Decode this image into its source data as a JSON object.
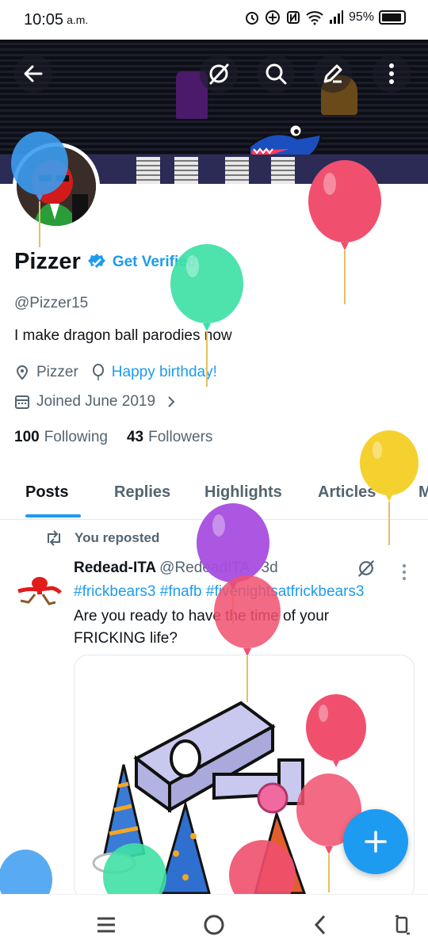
{
  "status_bar": {
    "time": "10:05",
    "ampm": "a.m.",
    "battery": "95%"
  },
  "icons": {
    "back": "back-arrow-icon",
    "grok": "grok-icon",
    "search": "search-icon",
    "edit": "edit-pencil-icon",
    "more": "more-vertical-icon",
    "verified": "verified-badge-icon",
    "location": "location-pin-icon",
    "birthday": "balloon-icon",
    "calendar": "calendar-icon",
    "repost": "repost-icon",
    "compose": "plus-icon"
  },
  "profile": {
    "name": "Pizzer",
    "get_verified": "Get Verified",
    "handle": "@Pizzer15",
    "bio": "I make dragon ball parodies now",
    "location": "Pizzer",
    "birthday": "Happy birthday!",
    "joined": "Joined June 2019",
    "following_count": "100",
    "following_label": "Following",
    "followers_count": "43",
    "followers_label": "Followers"
  },
  "tabs": [
    {
      "label": "Posts",
      "active": true
    },
    {
      "label": "Replies",
      "active": false
    },
    {
      "label": "Highlights",
      "active": false
    },
    {
      "label": "Articles",
      "active": false
    },
    {
      "label": "M",
      "active": false
    }
  ],
  "post": {
    "repost_label": "You reposted",
    "author": "Redead-ITA",
    "handle": "@RedeadITA",
    "dot": "·",
    "age": "3d",
    "hashtags": "#frickbears3 #fnafb #fivenightsatfrickbears3",
    "text": "Are you ready to have the time of your FRICKING life?"
  },
  "colors": {
    "accent": "#1d9bf0",
    "text_primary": "#0f1419",
    "text_secondary": "#536471",
    "balloon_blue": "#3b9cf0",
    "balloon_pink": "#f0506e",
    "balloon_green": "#3fe0a5",
    "balloon_yellow": "#f5d130",
    "balloon_purple": "#a64ee0"
  }
}
